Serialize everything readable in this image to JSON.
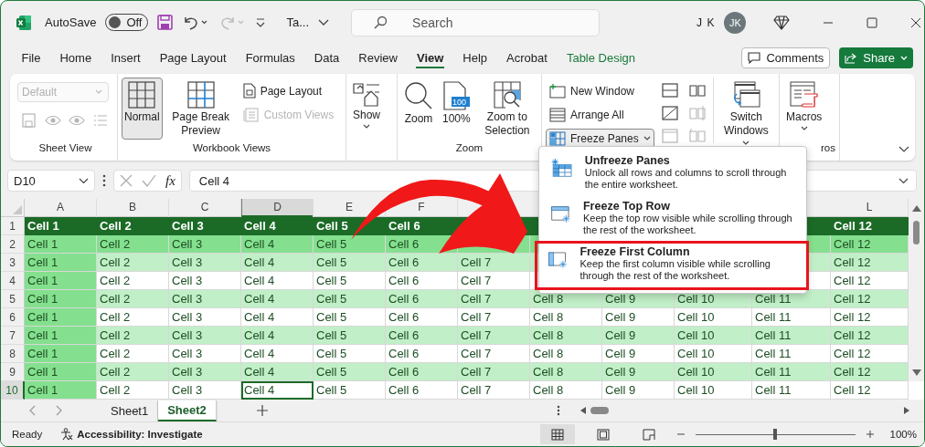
{
  "title_bar": {
    "autosave_label": "AutoSave",
    "autosave": {
      "label": "Off",
      "on": false
    },
    "file_name": "Ta...",
    "search": {
      "placeholder": "Search"
    },
    "user_initials": "J K",
    "avatar": "JK"
  },
  "tabs": [
    {
      "label": "File",
      "selected": false,
      "kind": "normal"
    },
    {
      "label": "Home",
      "selected": false,
      "kind": "normal"
    },
    {
      "label": "Insert",
      "selected": false,
      "kind": "normal"
    },
    {
      "label": "Page Layout",
      "selected": false,
      "kind": "normal"
    },
    {
      "label": "Formulas",
      "selected": false,
      "kind": "normal"
    },
    {
      "label": "Data",
      "selected": false,
      "kind": "normal"
    },
    {
      "label": "Review",
      "selected": false,
      "kind": "normal"
    },
    {
      "label": "View",
      "selected": true,
      "kind": "normal"
    },
    {
      "label": "Help",
      "selected": false,
      "kind": "normal"
    },
    {
      "label": "Acrobat",
      "selected": false,
      "kind": "normal"
    },
    {
      "label": "Table Design",
      "selected": false,
      "kind": "contextual"
    }
  ],
  "comments_button": "Comments",
  "share_button": "Share",
  "ribbon": {
    "sheet_view": {
      "label": "Sheet View",
      "view_select": {
        "value": "Default",
        "disabled": true
      },
      "tools": [
        {
          "disabled": true
        },
        {
          "disabled": true
        },
        {
          "disabled": true
        },
        {
          "disabled": true
        }
      ]
    },
    "workbook_views": {
      "label": "Workbook Views",
      "normal": {
        "label": "Normal",
        "selected": true
      },
      "page_break": {
        "label": "Page Break Preview",
        "selected": false
      },
      "page_layout": {
        "label": "Page Layout",
        "disabled": false
      },
      "custom_views": {
        "label": "Custom Views",
        "disabled": true
      }
    },
    "show": {
      "label": "Show"
    },
    "zoom": {
      "label": "Zoom",
      "zoom": "Zoom",
      "hundred": "100%",
      "hundred_badge": "100",
      "selection": "Zoom to Selection"
    },
    "window": {
      "new_window": "New Window",
      "arrange_all": "Arrange All",
      "freeze_panes": {
        "label": "Freeze Panes",
        "expanded": true
      },
      "tools": [
        {
          "disabled": false
        },
        {
          "disabled": false
        },
        {
          "disabled": true
        },
        {
          "disabled": false
        },
        {
          "disabled": true
        },
        {
          "disabled": true
        }
      ],
      "switch_windows": "Switch Windows"
    },
    "macros": {
      "label": "ros",
      "macros": "Macros"
    }
  },
  "freeze_menu": {
    "items": [
      {
        "title": "Unfreeze Panes",
        "description": "Unlock all rows and columns to scroll through the entire worksheet.",
        "highlighted": false
      },
      {
        "title": "Freeze Top Row",
        "description": "Keep the top row visible while scrolling through the rest of the worksheet.",
        "highlighted": false
      },
      {
        "title": "Freeze First Column",
        "description": "Keep the first column visible while scrolling through the rest of the worksheet.",
        "highlighted": true
      }
    ]
  },
  "formula_bar": {
    "name_box": "D10",
    "function_label": "fx",
    "formula": "Cell 4"
  },
  "sheet": {
    "first_column_emphasis": true,
    "columns": [
      {
        "label": "A",
        "selected": false
      },
      {
        "label": "B",
        "selected": false
      },
      {
        "label": "C",
        "selected": false
      },
      {
        "label": "D",
        "selected": true
      },
      {
        "label": "E",
        "selected": false
      },
      {
        "label": "F",
        "selected": false
      },
      null,
      null,
      null,
      null,
      null,
      {
        "label": "L",
        "selected": false
      }
    ],
    "rows": [
      {
        "header": "1",
        "kind": "header",
        "selected": false,
        "cells": [
          "Cell 1",
          "Cell 2",
          "Cell 3",
          "Cell 4",
          "Cell 5",
          "Cell 6",
          null,
          null,
          null,
          null,
          null,
          "Cell 12"
        ]
      },
      {
        "header": "2",
        "kind": "strong",
        "selected": false,
        "cells": [
          "Cell 1",
          "Cell 2",
          "Cell 3",
          "Cell 4",
          "Cell 5",
          "Cell 6",
          null,
          null,
          null,
          null,
          null,
          "Cell 12"
        ]
      },
      {
        "header": "3",
        "kind": "light",
        "selected": false,
        "cells": [
          "Cell 1",
          "Cell 2",
          "Cell 3",
          "Cell 4",
          "Cell 5",
          "Cell 6",
          "Cell 7",
          null,
          null,
          null,
          null,
          "Cell 12"
        ]
      },
      {
        "header": "4",
        "kind": "plain",
        "selected": false,
        "cells": [
          "Cell 1",
          "Cell 2",
          "Cell 3",
          "Cell 4",
          "Cell 5",
          "Cell 6",
          "Cell 7",
          null,
          null,
          null,
          null,
          "Cell 12"
        ]
      },
      {
        "header": "5",
        "kind": "light",
        "selected": false,
        "cells": [
          "Cell 1",
          "Cell 2",
          "Cell 3",
          "Cell 4",
          "Cell 5",
          "Cell 6",
          "Cell 7",
          "Cell 8",
          "Cell 9",
          "Cell 10",
          "Cell 11",
          "Cell 12"
        ]
      },
      {
        "header": "6",
        "kind": "plain",
        "selected": false,
        "cells": [
          "Cell 1",
          "Cell 2",
          "Cell 3",
          "Cell 4",
          "Cell 5",
          "Cell 6",
          "Cell 7",
          "Cell 8",
          "Cell 9",
          "Cell 10",
          "Cell 11",
          "Cell 12"
        ]
      },
      {
        "header": "7",
        "kind": "light",
        "selected": false,
        "cells": [
          "Cell 1",
          "Cell 2",
          "Cell 3",
          "Cell 4",
          "Cell 5",
          "Cell 6",
          "Cell 7",
          "Cell 8",
          "Cell 9",
          "Cell 10",
          "Cell 11",
          "Cell 12"
        ]
      },
      {
        "header": "8",
        "kind": "plain",
        "selected": false,
        "cells": [
          "Cell 1",
          "Cell 2",
          "Cell 3",
          "Cell 4",
          "Cell 5",
          "Cell 6",
          "Cell 7",
          "Cell 8",
          "Cell 9",
          "Cell 10",
          "Cell 11",
          "Cell 12"
        ]
      },
      {
        "header": "9",
        "kind": "light",
        "selected": false,
        "cells": [
          "Cell 1",
          "Cell 2",
          "Cell 3",
          "Cell 4",
          "Cell 5",
          "Cell 6",
          "Cell 7",
          "Cell 8",
          "Cell 9",
          "Cell 10",
          "Cell 11",
          "Cell 12"
        ]
      },
      {
        "header": "10",
        "kind": "plain",
        "selected": true,
        "cells": [
          "Cell 1",
          "Cell 2",
          "Cell 3",
          "Cell 4",
          "Cell 5",
          "Cell 6",
          "Cell 7",
          "Cell 8",
          "Cell 9",
          "Cell 10",
          "Cell 11",
          "Cell 12"
        ]
      }
    ]
  },
  "sheet_tabs": [
    {
      "label": "Sheet1",
      "selected": false
    },
    {
      "label": "Sheet2",
      "selected": true
    }
  ],
  "status_bar": {
    "mode": "Ready",
    "accessibility": "Accessibility: Investigate",
    "views": [
      {
        "selected": true
      },
      {
        "selected": false
      },
      {
        "selected": false
      }
    ],
    "zoom": {
      "level": 0.5,
      "reading": "100%"
    }
  }
}
